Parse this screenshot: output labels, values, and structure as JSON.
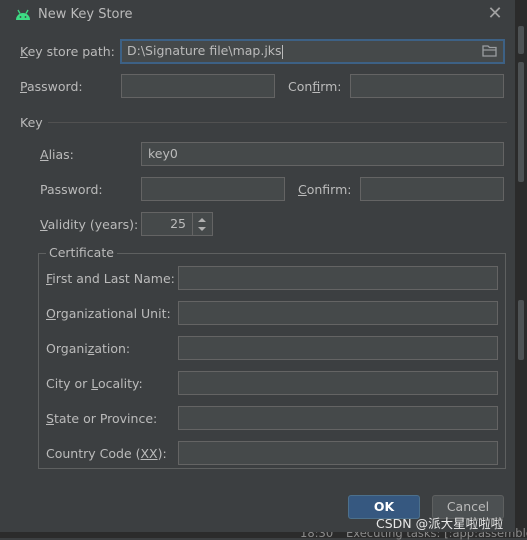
{
  "dialog": {
    "title": "New Key Store",
    "keystore_path": {
      "prefix": "",
      "underlined": "K",
      "rest": "ey store path:",
      "value": "D:\\Signature file\\map.jks"
    },
    "password_top": {
      "underlined": "P",
      "rest": "assword:"
    },
    "confirm_top": {
      "prefix": "Con",
      "underlined": "f",
      "rest": "irm:"
    },
    "key_section_label": "Key",
    "alias": {
      "underlined": "A",
      "rest": "lias:",
      "value": "key0"
    },
    "key_password": {
      "label": "Password:"
    },
    "key_confirm": {
      "underlined": "C",
      "rest": "onfirm:"
    },
    "validity": {
      "underlined": "V",
      "rest": "alidity (years):",
      "value": "25"
    },
    "certificate": {
      "legend": "Certificate",
      "fields": [
        {
          "underlined": "F",
          "rest": "irst and Last Name:"
        },
        {
          "underlined": "O",
          "rest": "rganizational Unit:"
        },
        {
          "underlined": "",
          "prefix": "Organi",
          "u2": "z",
          "rest": "ation:"
        },
        {
          "prefix": "City or ",
          "u2": "L",
          "rest": "ocality:"
        },
        {
          "prefix": "",
          "u2": "S",
          "rest": "tate or Province:"
        },
        {
          "prefix": "Country Code (",
          "u2": "XX",
          "rest": "):"
        }
      ]
    },
    "ok_label": "OK",
    "cancel_label": "Cancel"
  },
  "background": {
    "watermark": "CSDN @派大星啦啦啦",
    "time": "18:30",
    "status": "Executing tasks: [:app:assemble"
  },
  "colors": {
    "dialog_bg": "#3c3f41",
    "field_bg": "#45494a",
    "focus_border": "#3d6185",
    "ok_bg": "#365880",
    "android_green": "#3ddc84"
  },
  "icons": [
    "android-icon",
    "close-icon",
    "folder-icon",
    "spinner-up-icon",
    "spinner-down-icon"
  ]
}
